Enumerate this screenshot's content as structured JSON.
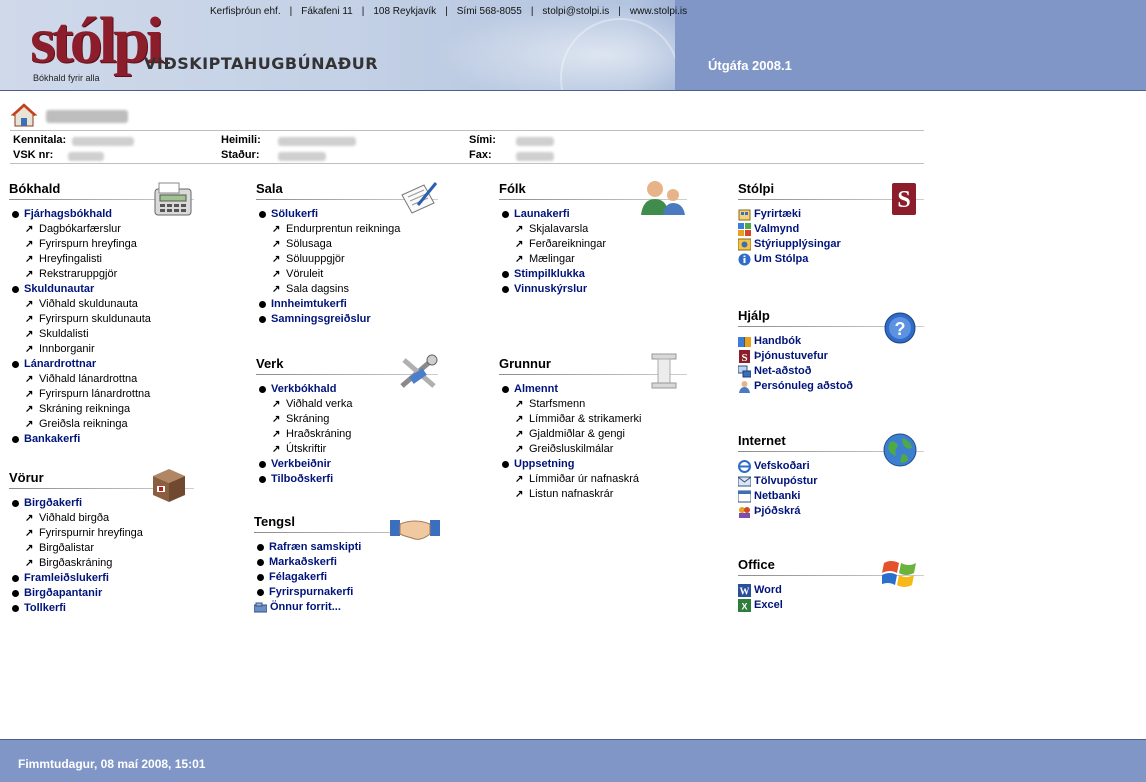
{
  "header": {
    "logo": "stólpi",
    "logo_subtitle": "VIÐSKIPTAHUGBÚNAÐUR",
    "logo_tagline": "Bókhald fyrir alla",
    "contact": [
      "Kerfisþróun ehf.",
      "Fákafeni 11",
      "108 Reykjavík",
      "Sími 568-8055",
      "stolpi@stolpi.is",
      "www.stolpi.is"
    ],
    "version": "Útgáfa 2008.1"
  },
  "company": {
    "labels": {
      "kennitala": "Kennitala:",
      "vsk": "VSK nr:",
      "heimili": "Heimili:",
      "stadur": "Staður:",
      "simi": "Sími:",
      "fax": "Fax:"
    }
  },
  "sections": {
    "bokhald": {
      "title": "Bókhald",
      "items": [
        {
          "label": "Fjárhagsbókhald",
          "type": "main"
        },
        {
          "label": "Dagbókarfærslur",
          "type": "sub"
        },
        {
          "label": "Fyrirspurn hreyfinga",
          "type": "sub"
        },
        {
          "label": "Hreyfingalisti",
          "type": "sub"
        },
        {
          "label": "Rekstraruppgjör",
          "type": "sub"
        },
        {
          "label": "Skuldunautar",
          "type": "main"
        },
        {
          "label": "Viðhald skuldunauta",
          "type": "sub"
        },
        {
          "label": "Fyrirspurn skuldunauta",
          "type": "sub"
        },
        {
          "label": "Skuldalisti",
          "type": "sub"
        },
        {
          "label": "Innborganir",
          "type": "sub"
        },
        {
          "label": "Lánardrottnar",
          "type": "main"
        },
        {
          "label": "Viðhald lánardrottna",
          "type": "sub"
        },
        {
          "label": "Fyrirspurn lánardrottna",
          "type": "sub"
        },
        {
          "label": "Skráning reikninga",
          "type": "sub"
        },
        {
          "label": "Greiðsla reikninga",
          "type": "sub"
        },
        {
          "label": "Bankakerfi",
          "type": "main"
        }
      ]
    },
    "vorur": {
      "title": "Vörur",
      "items": [
        {
          "label": "Birgðakerfi",
          "type": "main"
        },
        {
          "label": "Viðhald birgða",
          "type": "sub"
        },
        {
          "label": "Fyrirspurnir hreyfinga",
          "type": "sub"
        },
        {
          "label": "Birgðalistar",
          "type": "sub"
        },
        {
          "label": "Birgðaskráning",
          "type": "sub"
        },
        {
          "label": "Framleiðslukerfi",
          "type": "main"
        },
        {
          "label": "Birgðapantanir",
          "type": "main"
        },
        {
          "label": "Tollkerfi",
          "type": "main"
        }
      ]
    },
    "sala": {
      "title": "Sala",
      "items": [
        {
          "label": "Sölukerfi",
          "type": "main"
        },
        {
          "label": "Endurprentun reikninga",
          "type": "sub"
        },
        {
          "label": "Sölusaga",
          "type": "sub"
        },
        {
          "label": "Söluuppgjör",
          "type": "sub"
        },
        {
          "label": "Vöruleit",
          "type": "sub"
        },
        {
          "label": "Sala dagsins",
          "type": "sub"
        },
        {
          "label": "Innheimtukerfi",
          "type": "main"
        },
        {
          "label": "Samningsgreiðslur",
          "type": "main"
        }
      ]
    },
    "verk": {
      "title": "Verk",
      "items": [
        {
          "label": "Verkbókhald",
          "type": "main"
        },
        {
          "label": "Viðhald verka",
          "type": "sub"
        },
        {
          "label": "Skráning",
          "type": "sub"
        },
        {
          "label": "Hraðskráning",
          "type": "sub"
        },
        {
          "label": "Útskriftir",
          "type": "sub"
        },
        {
          "label": "Verkbeiðnir",
          "type": "main"
        },
        {
          "label": "Tilboðskerfi",
          "type": "main"
        }
      ]
    },
    "tengsl": {
      "title": "Tengsl",
      "items": [
        {
          "label": "Rafræn samskipti",
          "type": "main"
        },
        {
          "label": "Markaðskerfi",
          "type": "main"
        },
        {
          "label": "Félagakerfi",
          "type": "main"
        },
        {
          "label": "Fyrirspurnakerfi",
          "type": "main"
        },
        {
          "label": "Önnur forrit...",
          "type": "icon",
          "icon": "folder-icon"
        }
      ]
    },
    "folk": {
      "title": "Fólk",
      "items": [
        {
          "label": "Launakerfi",
          "type": "main"
        },
        {
          "label": "Skjalavarsla",
          "type": "sub"
        },
        {
          "label": "Ferðareikningar",
          "type": "sub"
        },
        {
          "label": "Mælingar",
          "type": "sub"
        },
        {
          "label": "Stimpilklukka",
          "type": "main"
        },
        {
          "label": "Vinnuskýrslur",
          "type": "main"
        }
      ]
    },
    "grunnur": {
      "title": "Grunnur",
      "items": [
        {
          "label": "Almennt",
          "type": "main"
        },
        {
          "label": "Starfsmenn",
          "type": "sub"
        },
        {
          "label": "Límmiðar & strikamerki",
          "type": "sub"
        },
        {
          "label": "Gjaldmiðlar & gengi",
          "type": "sub"
        },
        {
          "label": "Greiðsluskilmálar",
          "type": "sub"
        },
        {
          "label": "Uppsetning",
          "type": "main"
        },
        {
          "label": "Límmiðar úr nafnaskrá",
          "type": "sub"
        },
        {
          "label": "Listun nafnaskrár",
          "type": "sub"
        }
      ]
    },
    "stolpi": {
      "title": "Stólpi",
      "items": [
        {
          "label": "Fyrirtæki",
          "type": "icon",
          "icon": "company-icon"
        },
        {
          "label": "Valmynd",
          "type": "icon",
          "icon": "menu-icon"
        },
        {
          "label": "Stýriupplýsingar",
          "type": "icon",
          "icon": "settings-icon"
        },
        {
          "label": "Um Stólpa",
          "type": "icon",
          "icon": "info-icon"
        }
      ]
    },
    "hjalp": {
      "title": "Hjálp",
      "items": [
        {
          "label": "Handbók",
          "type": "icon",
          "icon": "book-icon"
        },
        {
          "label": "Þjónustuvefur",
          "type": "icon",
          "icon": "stolpi-s-icon"
        },
        {
          "label": "Net-aðstoð",
          "type": "icon",
          "icon": "network-icon"
        },
        {
          "label": "Persónuleg aðstoð",
          "type": "icon",
          "icon": "person-icon"
        }
      ]
    },
    "internet": {
      "title": "Internet",
      "items": [
        {
          "label": "Vefskoðari",
          "type": "icon",
          "icon": "browser-icon"
        },
        {
          "label": "Tölvupóstur",
          "type": "icon",
          "icon": "mail-icon"
        },
        {
          "label": "Netbanki",
          "type": "icon",
          "icon": "bank-icon"
        },
        {
          "label": "Þjóðskrá",
          "type": "icon",
          "icon": "registry-icon"
        }
      ]
    },
    "office": {
      "title": "Office",
      "items": [
        {
          "label": "Word",
          "type": "icon",
          "icon": "word-icon"
        },
        {
          "label": "Excel",
          "type": "icon",
          "icon": "excel-icon"
        }
      ]
    }
  },
  "footer": {
    "datetime": "Fimmtudagur, 08 maí 2008, 15:01"
  },
  "colors": {
    "link": "#00147a",
    "header_band": "#7f96c6",
    "logo": "#8b1e2a"
  }
}
